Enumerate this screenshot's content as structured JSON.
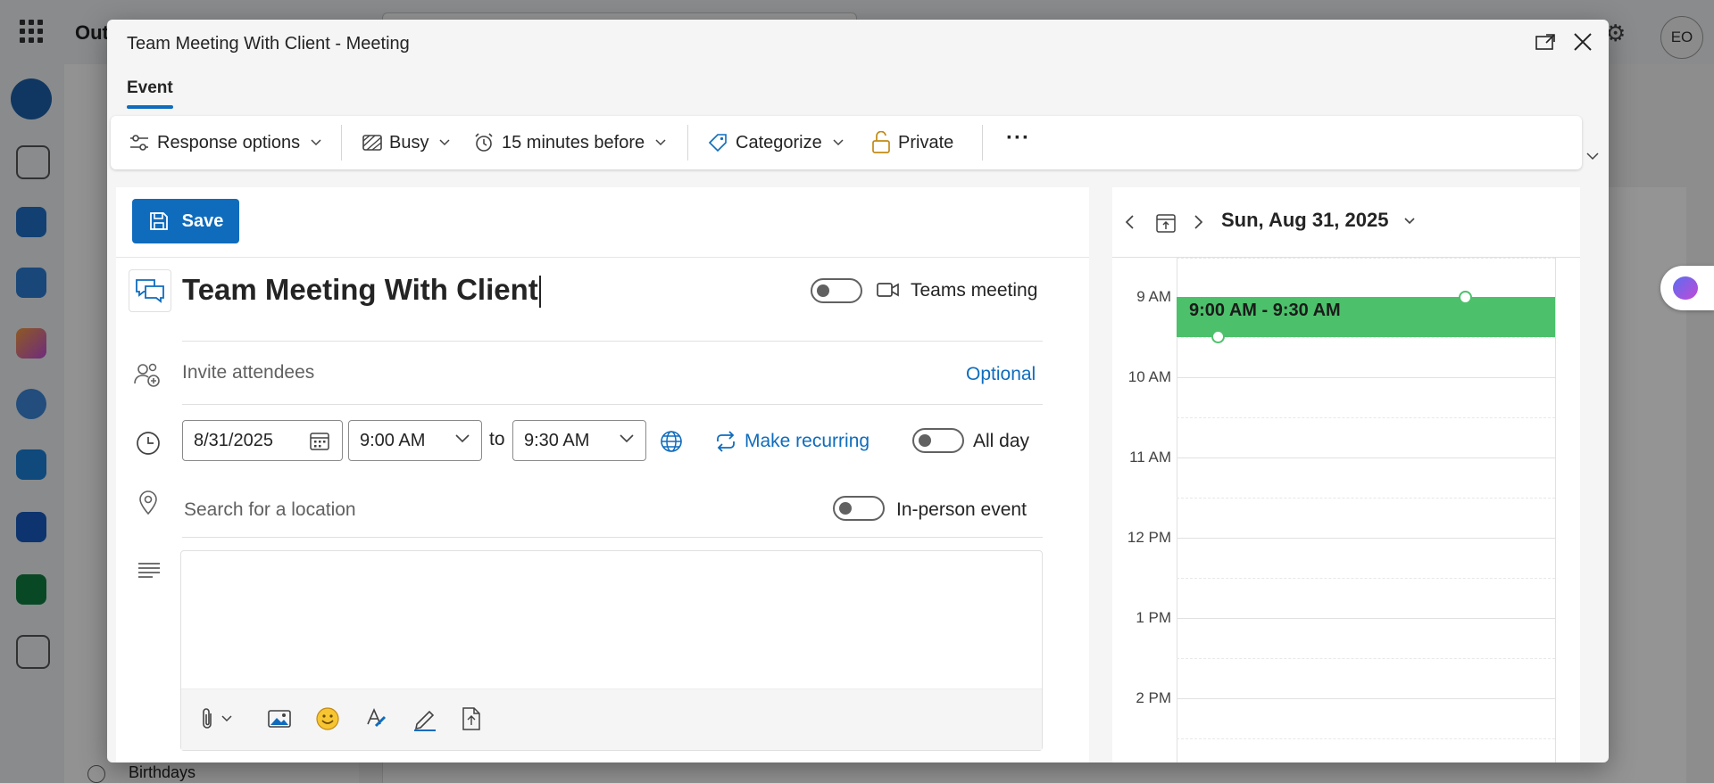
{
  "background": {
    "app_name": "Out",
    "avatar_initials": "EO",
    "birthdays_label": "Birthdays"
  },
  "dialog": {
    "title": "Team Meeting With Client - Meeting",
    "tab": "Event"
  },
  "toolbar": {
    "response_options": "Response options",
    "busy": "Busy",
    "reminder": "15 minutes before",
    "categorize": "Categorize",
    "private": "Private",
    "more": "···"
  },
  "form": {
    "save_label": "Save",
    "title_value": "Team Meeting With Client",
    "teams_label": "Teams meeting",
    "invite_placeholder": "Invite attendees",
    "optional_label": "Optional",
    "date_value": "8/31/2025",
    "start_time": "9:00 AM",
    "to_label": "to",
    "end_time": "9:30 AM",
    "recurring_label": "Make recurring",
    "all_day_label": "All day",
    "location_placeholder": "Search for a location",
    "in_person_label": "In-person event"
  },
  "calendar": {
    "date_label": "Sun, Aug 31, 2025",
    "hours": [
      "9 AM",
      "10 AM",
      "11 AM",
      "12 PM",
      "1 PM",
      "2 PM"
    ],
    "event_label": "9:00 AM - 9:30 AM",
    "event_color": "#4dc06b"
  },
  "colors": {
    "accent": "#0f6cbd"
  }
}
